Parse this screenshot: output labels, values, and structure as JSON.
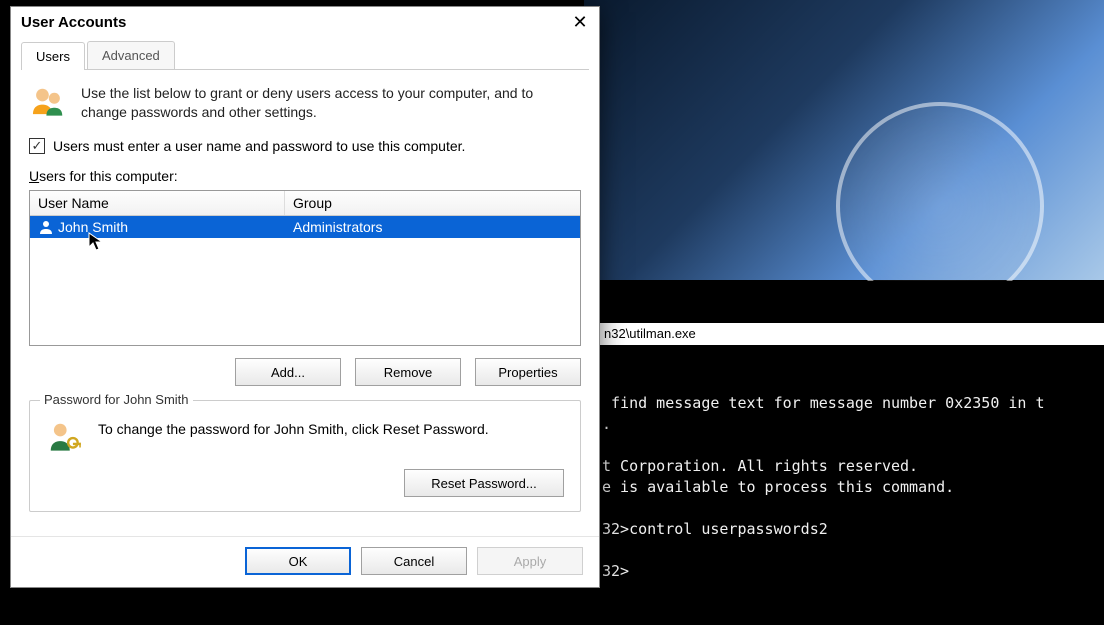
{
  "dialog": {
    "title": "User Accounts",
    "tabs": {
      "users": "Users",
      "advanced": "Advanced"
    },
    "intro": "Use the list below to grant or deny users access to your computer, and to change passwords and other settings.",
    "checkbox_label": "Users must enter a user name and password to use this computer.",
    "checkbox_checked": "✓",
    "list_label_prefix": "U",
    "list_label_rest": "sers for this computer:",
    "columns": {
      "name": "User Name",
      "group": "Group"
    },
    "rows": [
      {
        "name": "John Smith",
        "group": "Administrators"
      }
    ],
    "buttons": {
      "add": "Add...",
      "remove": "Remove",
      "properties": "Properties"
    },
    "password_group_title": "Password for John Smith",
    "password_text": "To change the password for John Smith, click Reset Password.",
    "reset_button": "Reset Password...",
    "actions": {
      "ok": "OK",
      "cancel": "Cancel",
      "apply": "Apply"
    }
  },
  "terminal": {
    "title": "n32\\utilman.exe",
    "lines": [
      " find message text for message number 0x2350 in t",
      ".",
      "",
      "t Corporation. All rights reserved.",
      "e is available to process this command.",
      "",
      "32>control userpasswords2",
      "",
      "32>"
    ]
  }
}
